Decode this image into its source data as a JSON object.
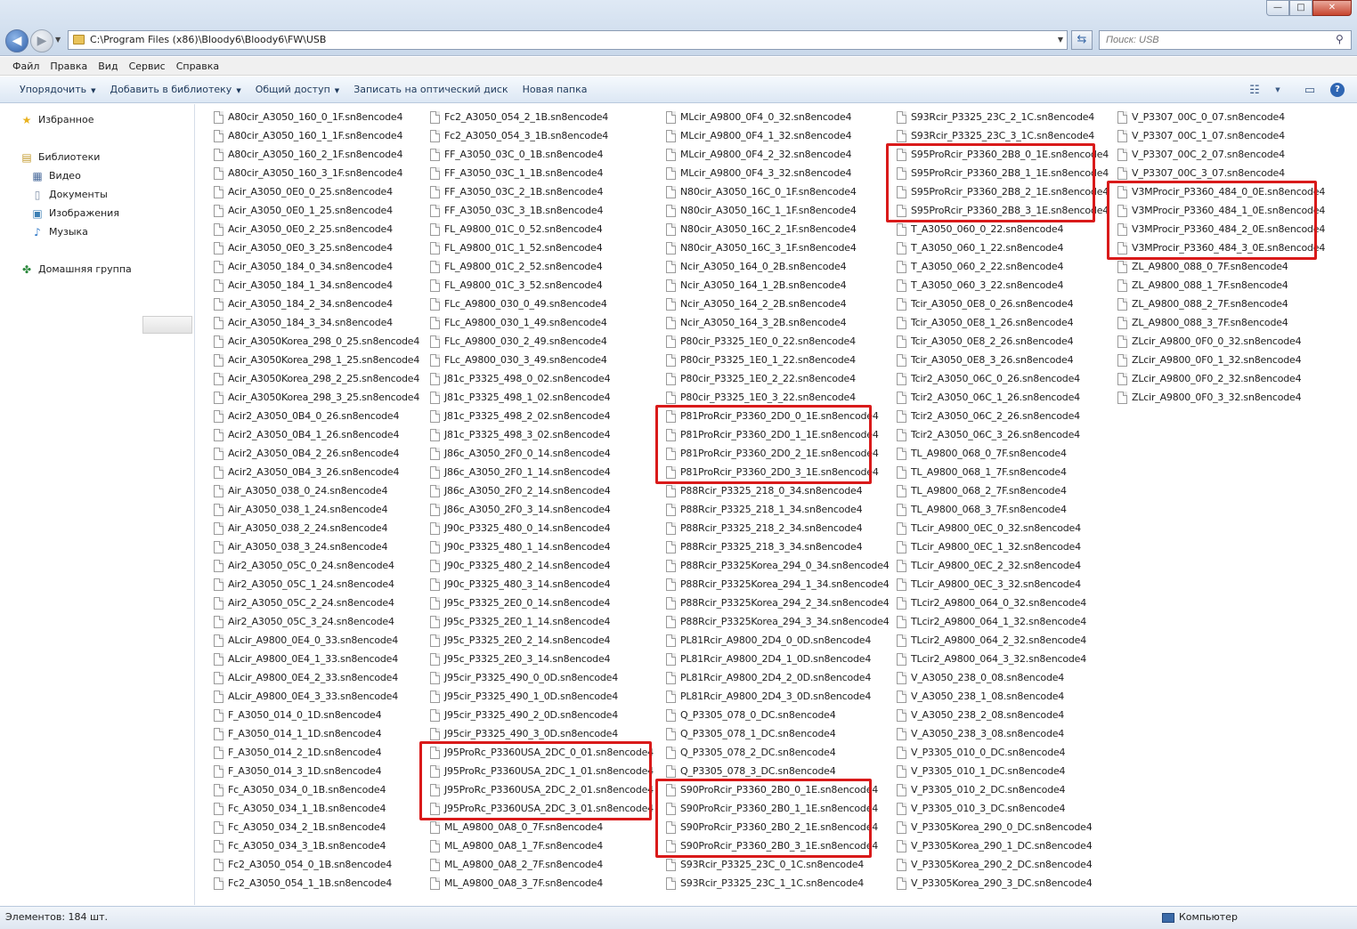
{
  "window": {
    "minimize": "—",
    "maximize": "□",
    "close": "✕"
  },
  "address": {
    "path": "C:\\Program Files (x86)\\Bloody6\\Bloody6\\FW\\USB",
    "search_placeholder": "Поиск: USB"
  },
  "menu": [
    "Файл",
    "Правка",
    "Вид",
    "Сервис",
    "Справка"
  ],
  "toolbar": {
    "organize": "Упорядочить",
    "add_library": "Добавить в библиотеку",
    "share": "Общий доступ",
    "burn": "Записать на оптический диск",
    "new_folder": "Новая папка"
  },
  "nav": {
    "favorites": "Избранное",
    "libraries": "Библиотеки",
    "video": "Видео",
    "documents": "Документы",
    "images": "Изображения",
    "music": "Музыка",
    "homegroup": "Домашняя группа"
  },
  "columns": [
    [
      "A80cir_A3050_160_0_1F.sn8encode4",
      "A80cir_A3050_160_1_1F.sn8encode4",
      "A80cir_A3050_160_2_1F.sn8encode4",
      "A80cir_A3050_160_3_1F.sn8encode4",
      "Acir_A3050_0E0_0_25.sn8encode4",
      "Acir_A3050_0E0_1_25.sn8encode4",
      "Acir_A3050_0E0_2_25.sn8encode4",
      "Acir_A3050_0E0_3_25.sn8encode4",
      "Acir_A3050_184_0_34.sn8encode4",
      "Acir_A3050_184_1_34.sn8encode4",
      "Acir_A3050_184_2_34.sn8encode4",
      "Acir_A3050_184_3_34.sn8encode4",
      "Acir_A3050Korea_298_0_25.sn8encode4",
      "Acir_A3050Korea_298_1_25.sn8encode4",
      "Acir_A3050Korea_298_2_25.sn8encode4",
      "Acir_A3050Korea_298_3_25.sn8encode4",
      "Acir2_A3050_0B4_0_26.sn8encode4",
      "Acir2_A3050_0B4_1_26.sn8encode4",
      "Acir2_A3050_0B4_2_26.sn8encode4",
      "Acir2_A3050_0B4_3_26.sn8encode4",
      "Air_A3050_038_0_24.sn8encode4",
      "Air_A3050_038_1_24.sn8encode4",
      "Air_A3050_038_2_24.sn8encode4",
      "Air_A3050_038_3_24.sn8encode4",
      "Air2_A3050_05C_0_24.sn8encode4",
      "Air2_A3050_05C_1_24.sn8encode4",
      "Air2_A3050_05C_2_24.sn8encode4",
      "Air2_A3050_05C_3_24.sn8encode4",
      "ALcir_A9800_0E4_0_33.sn8encode4",
      "ALcir_A9800_0E4_1_33.sn8encode4",
      "ALcir_A9800_0E4_2_33.sn8encode4",
      "ALcir_A9800_0E4_3_33.sn8encode4",
      "F_A3050_014_0_1D.sn8encode4",
      "F_A3050_014_1_1D.sn8encode4",
      "F_A3050_014_2_1D.sn8encode4",
      "F_A3050_014_3_1D.sn8encode4",
      "Fc_A3050_034_0_1B.sn8encode4",
      "Fc_A3050_034_1_1B.sn8encode4",
      "Fc_A3050_034_2_1B.sn8encode4",
      "Fc_A3050_034_3_1B.sn8encode4",
      "Fc2_A3050_054_0_1B.sn8encode4",
      "Fc2_A3050_054_1_1B.sn8encode4"
    ],
    [
      "Fc2_A3050_054_2_1B.sn8encode4",
      "Fc2_A3050_054_3_1B.sn8encode4",
      "FF_A3050_03C_0_1B.sn8encode4",
      "FF_A3050_03C_1_1B.sn8encode4",
      "FF_A3050_03C_2_1B.sn8encode4",
      "FF_A3050_03C_3_1B.sn8encode4",
      "FL_A9800_01C_0_52.sn8encode4",
      "FL_A9800_01C_1_52.sn8encode4",
      "FL_A9800_01C_2_52.sn8encode4",
      "FL_A9800_01C_3_52.sn8encode4",
      "FLc_A9800_030_0_49.sn8encode4",
      "FLc_A9800_030_1_49.sn8encode4",
      "FLc_A9800_030_2_49.sn8encode4",
      "FLc_A9800_030_3_49.sn8encode4",
      "J81c_P3325_498_0_02.sn8encode4",
      "J81c_P3325_498_1_02.sn8encode4",
      "J81c_P3325_498_2_02.sn8encode4",
      "J81c_P3325_498_3_02.sn8encode4",
      "J86c_A3050_2F0_0_14.sn8encode4",
      "J86c_A3050_2F0_1_14.sn8encode4",
      "J86c_A3050_2F0_2_14.sn8encode4",
      "J86c_A3050_2F0_3_14.sn8encode4",
      "J90c_P3325_480_0_14.sn8encode4",
      "J90c_P3325_480_1_14.sn8encode4",
      "J90c_P3325_480_2_14.sn8encode4",
      "J90c_P3325_480_3_14.sn8encode4",
      "J95c_P3325_2E0_0_14.sn8encode4",
      "J95c_P3325_2E0_1_14.sn8encode4",
      "J95c_P3325_2E0_2_14.sn8encode4",
      "J95c_P3325_2E0_3_14.sn8encode4",
      "J95cir_P3325_490_0_0D.sn8encode4",
      "J95cir_P3325_490_1_0D.sn8encode4",
      "J95cir_P3325_490_2_0D.sn8encode4",
      "J95cir_P3325_490_3_0D.sn8encode4",
      "J95ProRc_P3360USA_2DC_0_01.sn8encode4",
      "J95ProRc_P3360USA_2DC_1_01.sn8encode4",
      "J95ProRc_P3360USA_2DC_2_01.sn8encode4",
      "J95ProRc_P3360USA_2DC_3_01.sn8encode4",
      "ML_A9800_0A8_0_7F.sn8encode4",
      "ML_A9800_0A8_1_7F.sn8encode4",
      "ML_A9800_0A8_2_7F.sn8encode4",
      "ML_A9800_0A8_3_7F.sn8encode4"
    ],
    [
      "MLcir_A9800_0F4_0_32.sn8encode4",
      "MLcir_A9800_0F4_1_32.sn8encode4",
      "MLcir_A9800_0F4_2_32.sn8encode4",
      "MLcir_A9800_0F4_3_32.sn8encode4",
      "N80cir_A3050_16C_0_1F.sn8encode4",
      "N80cir_A3050_16C_1_1F.sn8encode4",
      "N80cir_A3050_16C_2_1F.sn8encode4",
      "N80cir_A3050_16C_3_1F.sn8encode4",
      "Ncir_A3050_164_0_2B.sn8encode4",
      "Ncir_A3050_164_1_2B.sn8encode4",
      "Ncir_A3050_164_2_2B.sn8encode4",
      "Ncir_A3050_164_3_2B.sn8encode4",
      "P80cir_P3325_1E0_0_22.sn8encode4",
      "P80cir_P3325_1E0_1_22.sn8encode4",
      "P80cir_P3325_1E0_2_22.sn8encode4",
      "P80cir_P3325_1E0_3_22.sn8encode4",
      "P81ProRcir_P3360_2D0_0_1E.sn8encode4",
      "P81ProRcir_P3360_2D0_1_1E.sn8encode4",
      "P81ProRcir_P3360_2D0_2_1E.sn8encode4",
      "P81ProRcir_P3360_2D0_3_1E.sn8encode4",
      "P88Rcir_P3325_218_0_34.sn8encode4",
      "P88Rcir_P3325_218_1_34.sn8encode4",
      "P88Rcir_P3325_218_2_34.sn8encode4",
      "P88Rcir_P3325_218_3_34.sn8encode4",
      "P88Rcir_P3325Korea_294_0_34.sn8encode4",
      "P88Rcir_P3325Korea_294_1_34.sn8encode4",
      "P88Rcir_P3325Korea_294_2_34.sn8encode4",
      "P88Rcir_P3325Korea_294_3_34.sn8encode4",
      "PL81Rcir_A9800_2D4_0_0D.sn8encode4",
      "PL81Rcir_A9800_2D4_1_0D.sn8encode4",
      "PL81Rcir_A9800_2D4_2_0D.sn8encode4",
      "PL81Rcir_A9800_2D4_3_0D.sn8encode4",
      "Q_P3305_078_0_DC.sn8encode4",
      "Q_P3305_078_1_DC.sn8encode4",
      "Q_P3305_078_2_DC.sn8encode4",
      "Q_P3305_078_3_DC.sn8encode4",
      "S90ProRcir_P3360_2B0_0_1E.sn8encode4",
      "S90ProRcir_P3360_2B0_1_1E.sn8encode4",
      "S90ProRcir_P3360_2B0_2_1E.sn8encode4",
      "S90ProRcir_P3360_2B0_3_1E.sn8encode4",
      "S93Rcir_P3325_23C_0_1C.sn8encode4",
      "S93Rcir_P3325_23C_1_1C.sn8encode4"
    ],
    [
      "S93Rcir_P3325_23C_2_1C.sn8encode4",
      "S93Rcir_P3325_23C_3_1C.sn8encode4",
      "S95ProRcir_P3360_2B8_0_1E.sn8encode4",
      "S95ProRcir_P3360_2B8_1_1E.sn8encode4",
      "S95ProRcir_P3360_2B8_2_1E.sn8encode4",
      "S95ProRcir_P3360_2B8_3_1E.sn8encode4",
      "T_A3050_060_0_22.sn8encode4",
      "T_A3050_060_1_22.sn8encode4",
      "T_A3050_060_2_22.sn8encode4",
      "T_A3050_060_3_22.sn8encode4",
      "Tcir_A3050_0E8_0_26.sn8encode4",
      "Tcir_A3050_0E8_1_26.sn8encode4",
      "Tcir_A3050_0E8_2_26.sn8encode4",
      "Tcir_A3050_0E8_3_26.sn8encode4",
      "Tcir2_A3050_06C_0_26.sn8encode4",
      "Tcir2_A3050_06C_1_26.sn8encode4",
      "Tcir2_A3050_06C_2_26.sn8encode4",
      "Tcir2_A3050_06C_3_26.sn8encode4",
      "TL_A9800_068_0_7F.sn8encode4",
      "TL_A9800_068_1_7F.sn8encode4",
      "TL_A9800_068_2_7F.sn8encode4",
      "TL_A9800_068_3_7F.sn8encode4",
      "TLcir_A9800_0EC_0_32.sn8encode4",
      "TLcir_A9800_0EC_1_32.sn8encode4",
      "TLcir_A9800_0EC_2_32.sn8encode4",
      "TLcir_A9800_0EC_3_32.sn8encode4",
      "TLcir2_A9800_064_0_32.sn8encode4",
      "TLcir2_A9800_064_1_32.sn8encode4",
      "TLcir2_A9800_064_2_32.sn8encode4",
      "TLcir2_A9800_064_3_32.sn8encode4",
      "V_A3050_238_0_08.sn8encode4",
      "V_A3050_238_1_08.sn8encode4",
      "V_A3050_238_2_08.sn8encode4",
      "V_A3050_238_3_08.sn8encode4",
      "V_P3305_010_0_DC.sn8encode4",
      "V_P3305_010_1_DC.sn8encode4",
      "V_P3305_010_2_DC.sn8encode4",
      "V_P3305_010_3_DC.sn8encode4",
      "V_P3305Korea_290_0_DC.sn8encode4",
      "V_P3305Korea_290_1_DC.sn8encode4",
      "V_P3305Korea_290_2_DC.sn8encode4",
      "V_P3305Korea_290_3_DC.sn8encode4"
    ],
    [
      "V_P3307_00C_0_07.sn8encode4",
      "V_P3307_00C_1_07.sn8encode4",
      "V_P3307_00C_2_07.sn8encode4",
      "V_P3307_00C_3_07.sn8encode4",
      "V3MProcir_P3360_484_0_0E.sn8encode4",
      "V3MProcir_P3360_484_1_0E.sn8encode4",
      "V3MProcir_P3360_484_2_0E.sn8encode4",
      "V3MProcir_P3360_484_3_0E.sn8encode4",
      "ZL_A9800_088_0_7F.sn8encode4",
      "ZL_A9800_088_1_7F.sn8encode4",
      "ZL_A9800_088_2_7F.sn8encode4",
      "ZL_A9800_088_3_7F.sn8encode4",
      "ZLcir_A9800_0F0_0_32.sn8encode4",
      "ZLcir_A9800_0F0_1_32.sn8encode4",
      "ZLcir_A9800_0F0_2_32.sn8encode4",
      "ZLcir_A9800_0F0_3_32.sn8encode4"
    ]
  ],
  "highlight_color": "#d91a1a",
  "highlighted_groups": [
    {
      "column": 1,
      "first_row": 34,
      "row_count": 4
    },
    {
      "column": 2,
      "first_row": 16,
      "row_count": 4
    },
    {
      "column": 2,
      "first_row": 36,
      "row_count": 4
    },
    {
      "column": 3,
      "first_row": 2,
      "row_count": 4
    },
    {
      "column": 4,
      "first_row": 4,
      "row_count": 4
    }
  ],
  "status": {
    "items_count": "Элементов: 184 шт.",
    "location": "Компьютер"
  }
}
